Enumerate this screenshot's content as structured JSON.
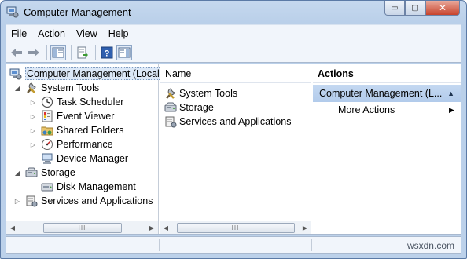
{
  "window": {
    "title": "Computer Management",
    "close_glyph": "✕",
    "min_glyph": "▭",
    "max_glyph": "▢"
  },
  "menu": [
    "File",
    "Action",
    "View",
    "Help"
  ],
  "toolbar_icons": [
    "back-arrow-icon",
    "forward-arrow-icon",
    "show-hide-console-tree-icon",
    "export-list-icon",
    "help-icon",
    "show-hide-action-pane-icon"
  ],
  "tree": {
    "root": "Computer Management (Local",
    "items": [
      {
        "label": "System Tools",
        "icon": "tools-icon",
        "level": 1,
        "expander": "open"
      },
      {
        "label": "Task Scheduler",
        "icon": "clock-icon",
        "level": 2,
        "expander": "closed"
      },
      {
        "label": "Event Viewer",
        "icon": "event-viewer-icon",
        "level": 2,
        "expander": "closed"
      },
      {
        "label": "Shared Folders",
        "icon": "shared-folder-icon",
        "level": 2,
        "expander": "closed"
      },
      {
        "label": "Performance",
        "icon": "performance-icon",
        "level": 2,
        "expander": "closed"
      },
      {
        "label": "Device Manager",
        "icon": "device-manager-icon",
        "level": 2,
        "expander": "none"
      },
      {
        "label": "Storage",
        "icon": "storage-icon",
        "level": 1,
        "expander": "open"
      },
      {
        "label": "Disk Management",
        "icon": "disk-icon",
        "level": 2,
        "expander": "none"
      },
      {
        "label": "Services and Applications",
        "icon": "services-icon",
        "level": 1,
        "expander": "closed"
      }
    ]
  },
  "middle": {
    "column_header": "Name",
    "items": [
      {
        "label": "System Tools",
        "icon": "tools-icon"
      },
      {
        "label": "Storage",
        "icon": "storage-icon"
      },
      {
        "label": "Services and Applications",
        "icon": "services-icon"
      }
    ]
  },
  "actions": {
    "header": "Actions",
    "group": "Computer Management (L...",
    "items": [
      "More Actions"
    ]
  },
  "scrollbar": {
    "thumb_grip": "III"
  },
  "watermark": "wsxdn.com"
}
